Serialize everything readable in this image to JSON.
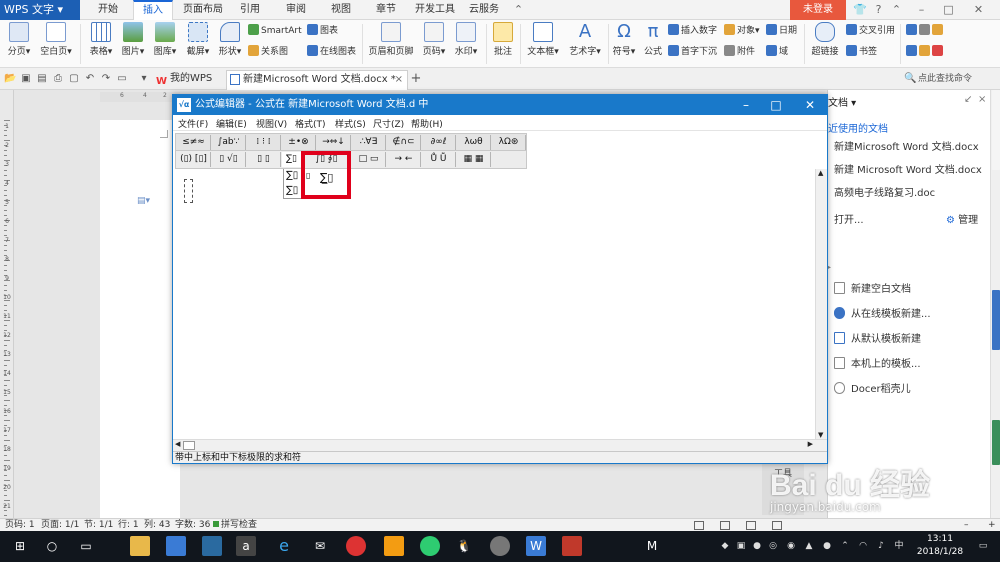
{
  "app": {
    "name": "WPS 文字",
    "login_label": "未登录"
  },
  "ribbon_tabs": [
    "开始",
    "插入",
    "页面布局",
    "引用",
    "审阅",
    "视图",
    "章节",
    "开发工具",
    "云服务"
  ],
  "ribbon_active_tab": "插入",
  "ribbon": {
    "page_break": "分页",
    "blank_page": "空白页",
    "table": "表格",
    "picture": "图片",
    "gallery": "图库",
    "screenshot": "截屏",
    "shape": "形状",
    "smartart": "SmartArt",
    "chart": "图表",
    "relation": "关系图",
    "online_chart": "在线图表",
    "header_footer": "页眉和页脚",
    "page_number": "页码",
    "watermark": "水印",
    "comment": "批注",
    "textbox": "文本框",
    "wordart": "艺术字",
    "symbol": "符号",
    "formula": "公式",
    "insert_number": "插入数字",
    "object": "对象",
    "date": "日期",
    "drop_cap": "首字下沉",
    "attachment": "附件",
    "field": "域",
    "cross_ref": "交叉引用",
    "hyperlink": "超链接",
    "bookmark": "书签"
  },
  "doc_tabs": [
    {
      "label": "我的WPS",
      "active": false
    },
    {
      "label": "新建Microsoft Word 文档.docx *",
      "active": true
    }
  ],
  "search_placeholder": "点此查找命令",
  "ruler_numbers": [
    "6",
    "4",
    "2"
  ],
  "vruler_numbers": [
    "1",
    "2",
    "3",
    "4",
    "5",
    "6",
    "7",
    "8",
    "9",
    "10",
    "11",
    "12",
    "13",
    "14",
    "15",
    "16",
    "17",
    "18",
    "19",
    "20",
    "21"
  ],
  "eq_editor": {
    "title": "公式编辑器 - 公式在 新建Microsoft Word 文档.d 中",
    "menu": [
      "文件(F)",
      "编辑(E)",
      "视图(V)",
      "格式(T)",
      "样式(S)",
      "尺寸(Z)",
      "帮助(H)"
    ],
    "palette_row1": [
      "≤≠≈",
      "∫ab∵",
      "⁞ ⁝ ⁞",
      "±•⊗",
      "→⇔↓",
      "∴∀∃",
      "∉∩⊂",
      "∂∞ℓ",
      "λωθ",
      "λΩ⊛"
    ],
    "palette_row2": [
      "(▯) [▯]",
      "▯ √▯",
      "▯ ▯",
      "∑▯",
      "∫▯ ∮▯",
      "□ ▭",
      "→ ←",
      "Ů Ṻ",
      "▦ ▦"
    ],
    "dropdown_items": [
      "∑▯",
      "∑▯"
    ],
    "status": "带中上标和中下标极限的求和符"
  },
  "task_pane": {
    "header": "文档",
    "recent_title": "近使用的文档",
    "recent_files": [
      "新建Microsoft Word 文档.docx",
      "新建 Microsoft Word 文档.docx",
      "高频电子线路复习.doc"
    ],
    "open": "打开...",
    "manage": "管理",
    "new_items": [
      "新建空白文档",
      "从在线模板新建...",
      "从默认模板新建",
      "本机上的模板...",
      "Docer稻壳儿"
    ]
  },
  "toolbox_label": "工具",
  "status_bar": {
    "page_num": "页码: 1",
    "pages": "页面: 1/1",
    "section": "节: 1/1",
    "row": "行: 1",
    "col": "列: 43",
    "words": "字数: 36",
    "spell": "拼写检查"
  },
  "taskbar": {
    "time": "13:11",
    "date": "2018/1/28"
  },
  "watermark": {
    "brand": "Bai du 经验",
    "url": "jingyan.baidu.com"
  }
}
